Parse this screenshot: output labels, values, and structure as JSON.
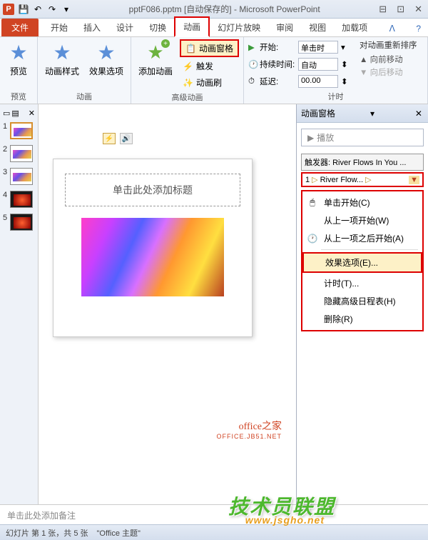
{
  "title": {
    "filename": "pptF086.pptm",
    "autosave": "[自动保存的]",
    "app": "Microsoft PowerPoint"
  },
  "tabs": {
    "file": "文件",
    "home": "开始",
    "insert": "插入",
    "design": "设计",
    "transitions": "切换",
    "animations": "动画",
    "slideshow": "幻灯片放映",
    "review": "审阅",
    "view": "视图",
    "addins": "加载项"
  },
  "ribbon": {
    "preview_group": "预览",
    "preview_btn": "预览",
    "animation_group": "动画",
    "styles_btn": "动画样式",
    "effect_btn": "效果选项",
    "advanced_group": "高级动画",
    "add_btn": "添加动画",
    "pane_btn": "动画窗格",
    "trigger_btn": "触发",
    "painter_btn": "动画刷",
    "timing_group": "计时",
    "start_lbl": "开始:",
    "start_val": "单击时",
    "duration_lbl": "持续时间:",
    "duration_val": "自动",
    "delay_lbl": "延迟:",
    "delay_val": "00.00",
    "reorder_hdr": "对动画重新排序",
    "move_earlier": "向前移动",
    "move_later": "向后移动"
  },
  "thumbs": [
    "1",
    "2",
    "3",
    "4",
    "5"
  ],
  "slide": {
    "title_placeholder": "单击此处添加标题"
  },
  "pane": {
    "header": "动画窗格",
    "play": "播放",
    "trigger_label": "触发器: River Flows In You ...",
    "item_num": "1",
    "item_name": "River Flow...",
    "ctx_click": "单击开始(C)",
    "ctx_prev": "从上一项开始(W)",
    "ctx_after": "从上一项之后开始(A)",
    "ctx_effect": "效果选项(E)...",
    "ctx_timing": "计时(T)...",
    "ctx_hide": "隐藏高级日程表(H)",
    "ctx_delete": "删除(R)"
  },
  "brand": {
    "name": "office之家",
    "url": "OFFICE.JB51.NET",
    "overlay": "技术员联盟",
    "overlay_url": "www.jsgho.net"
  },
  "notes": "单击此处添加备注",
  "status": {
    "slide": "幻灯片 第 1 张，共 5 张",
    "theme": "\"Office 主题\""
  }
}
